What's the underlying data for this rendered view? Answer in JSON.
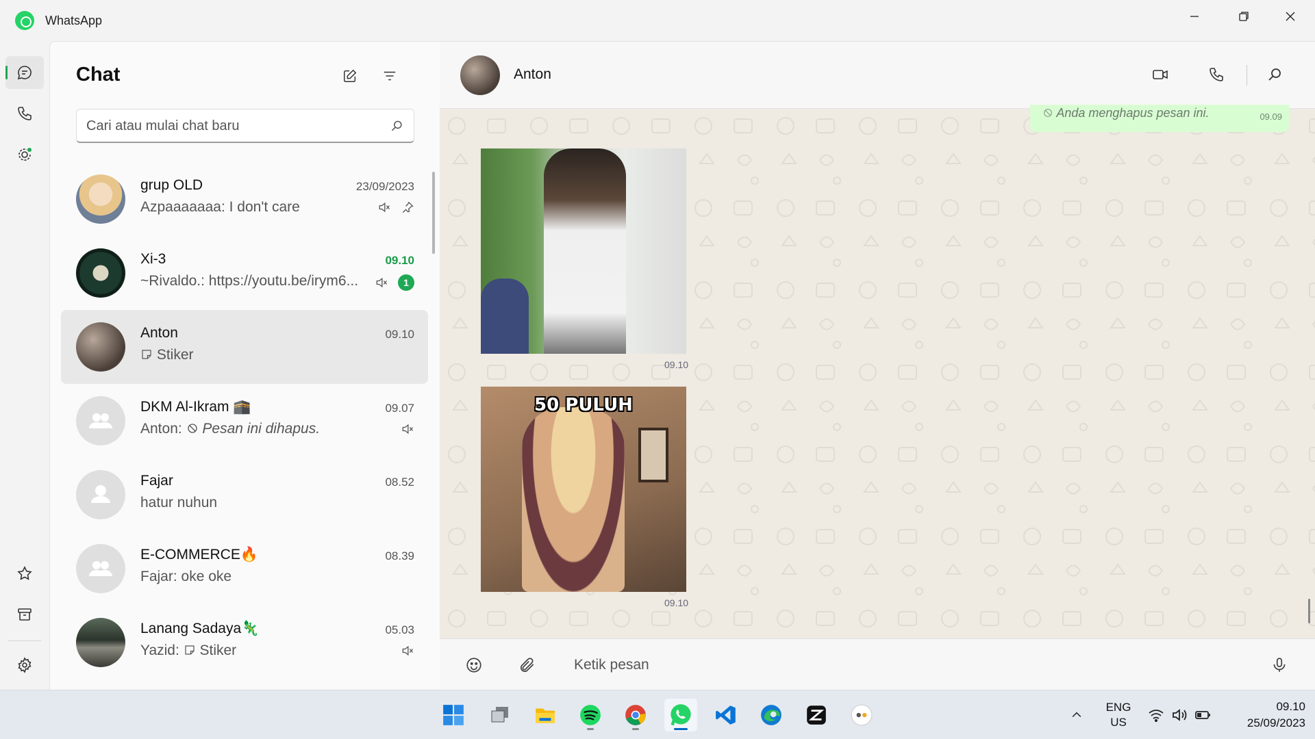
{
  "window": {
    "title": "WhatsApp",
    "minimize_icon": "minimize-icon",
    "restore_icon": "restore-icon",
    "close_icon": "close-icon"
  },
  "rail": {
    "items": [
      {
        "name": "chats",
        "icon": "chat-bubble-icon",
        "active": true
      },
      {
        "name": "calls",
        "icon": "phone-icon"
      },
      {
        "name": "status",
        "icon": "status-icon"
      },
      {
        "name": "starred",
        "icon": "star-icon"
      },
      {
        "name": "archived",
        "icon": "archive-icon"
      },
      {
        "name": "settings",
        "icon": "gear-icon"
      }
    ]
  },
  "list": {
    "title": "Chat",
    "search_placeholder": "Cari atau mulai chat baru",
    "chats": [
      {
        "name": "grup OLD",
        "preview": "Azpaaaaaaa: I don't care",
        "time": "23/09/2023",
        "muted": true,
        "pinned": true
      },
      {
        "name": "Xi-3",
        "preview": "~Rivaldo.: https://youtu.be/irym6...",
        "time": "09.10",
        "unread": "1",
        "muted": true
      },
      {
        "name": "Anton",
        "preview": "Stiker",
        "time": "09.10",
        "selected": true
      },
      {
        "name": "DKM Al-Ikram 🕋",
        "preview_prefix": "Anton:",
        "preview": "Pesan ini dihapus.",
        "time": "09.07",
        "muted": true
      },
      {
        "name": "Fajar",
        "preview": "hatur nuhun",
        "time": "08.52"
      },
      {
        "name": "E-COMMERCE🔥",
        "preview": "Fajar: oke oke",
        "time": "08.39"
      },
      {
        "name": "Lanang Sadaya🦎",
        "preview_prefix": "Yazid:",
        "preview": "Stiker",
        "time": "05.03",
        "muted": true
      }
    ]
  },
  "conversation": {
    "contact": "Anton",
    "deleted_message": "Anda menghapus pesan ini.",
    "deleted_time": "09.09",
    "stickers": [
      {
        "time": "09.10"
      },
      {
        "caption": "50 PULUH",
        "time": "09.10"
      }
    ],
    "composer_placeholder": "Ketik pesan"
  },
  "taskbar": {
    "apps": [
      "start",
      "task-view",
      "file-explorer",
      "spotify",
      "chrome",
      "whatsapp",
      "vscode",
      "edge",
      "capcut",
      "app"
    ],
    "active": "whatsapp",
    "lang_1": "ENG",
    "lang_2": "US",
    "time": "09.10",
    "date": "25/09/2023"
  },
  "colors": {
    "accent": "#1fa855",
    "chat_bg": "#efeae2",
    "sent_bubble": "#d9fdd3"
  }
}
